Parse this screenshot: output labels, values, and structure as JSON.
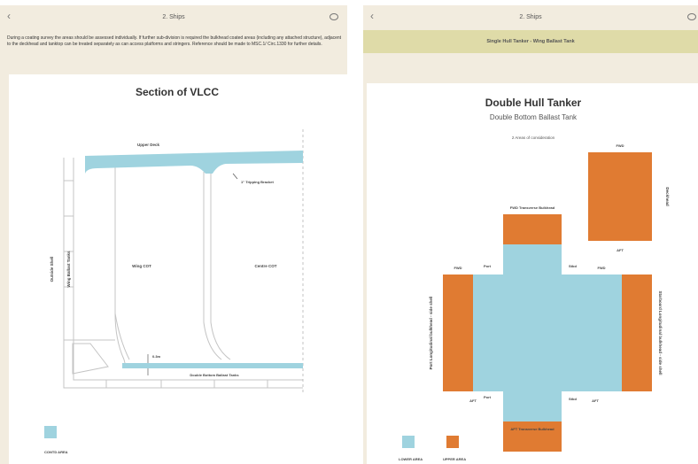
{
  "left": {
    "header_title": "2. Ships",
    "intro_text": "During a coating survey the areas should be assessed individually. If further sub-division is required the bulkhead coated areas (including any attached structure), adjacent to the deckhead and tanktop can be treated separately as can access platforms and stringers. Reference should be made to MSC.1/ Circ.1330 for further details.",
    "diagram": {
      "title": "Section of VLCC",
      "labels": {
        "upper_deck": "Upper Deck",
        "tripping_bracket": "1\" Tripping Bracket",
        "outside_shell": "Outside Shell",
        "wing_ballast_tanks": "Wing Ballast Tanks",
        "wing_cot": "Wing COT",
        "centre_cot": "Centre COT",
        "dimension": "0.3m",
        "double_bottom": "Double Bottom Ballast Tanks"
      },
      "legend": [
        {
          "label": "CONTD AREA",
          "color": "#9fd3df"
        }
      ]
    }
  },
  "right": {
    "header_title": "2. Ships",
    "subheader": "Single Hull Tanker - Wing Ballast Tank",
    "diagram": {
      "title": "Double Hull Tanker",
      "subtitle": "Double Bottom Ballast Tank",
      "caption": "2 Areas of consideration",
      "labels": {
        "fwd_top": "FWD",
        "deckhead": "Deckhead",
        "aft_top": "AFT",
        "fwd_transverse": "FWD Transverse Bulkhead",
        "port_top": "Port",
        "stbd_top": "Stbd",
        "fwd_left": "FWD",
        "fwd_right": "FWD",
        "port_long": "Port Longitudinal bulkhead - side shell",
        "stbd_long": "Starboard Longitudinal bulkhead - side shell",
        "aft_left": "AFT",
        "aft_right": "AFT",
        "port_bottom": "Port",
        "stbd_bottom": "Stbd",
        "aft_transverse": "AFT Transverse Bulkhead"
      },
      "legend": [
        {
          "label": "LOWER AREA",
          "color": "#9fd3df"
        },
        {
          "label": "UPPER AREA",
          "color": "#e07b32"
        }
      ]
    }
  },
  "colors": {
    "blue": "#9fd3df",
    "orange": "#e07b32",
    "line": "#b7b7b7"
  }
}
